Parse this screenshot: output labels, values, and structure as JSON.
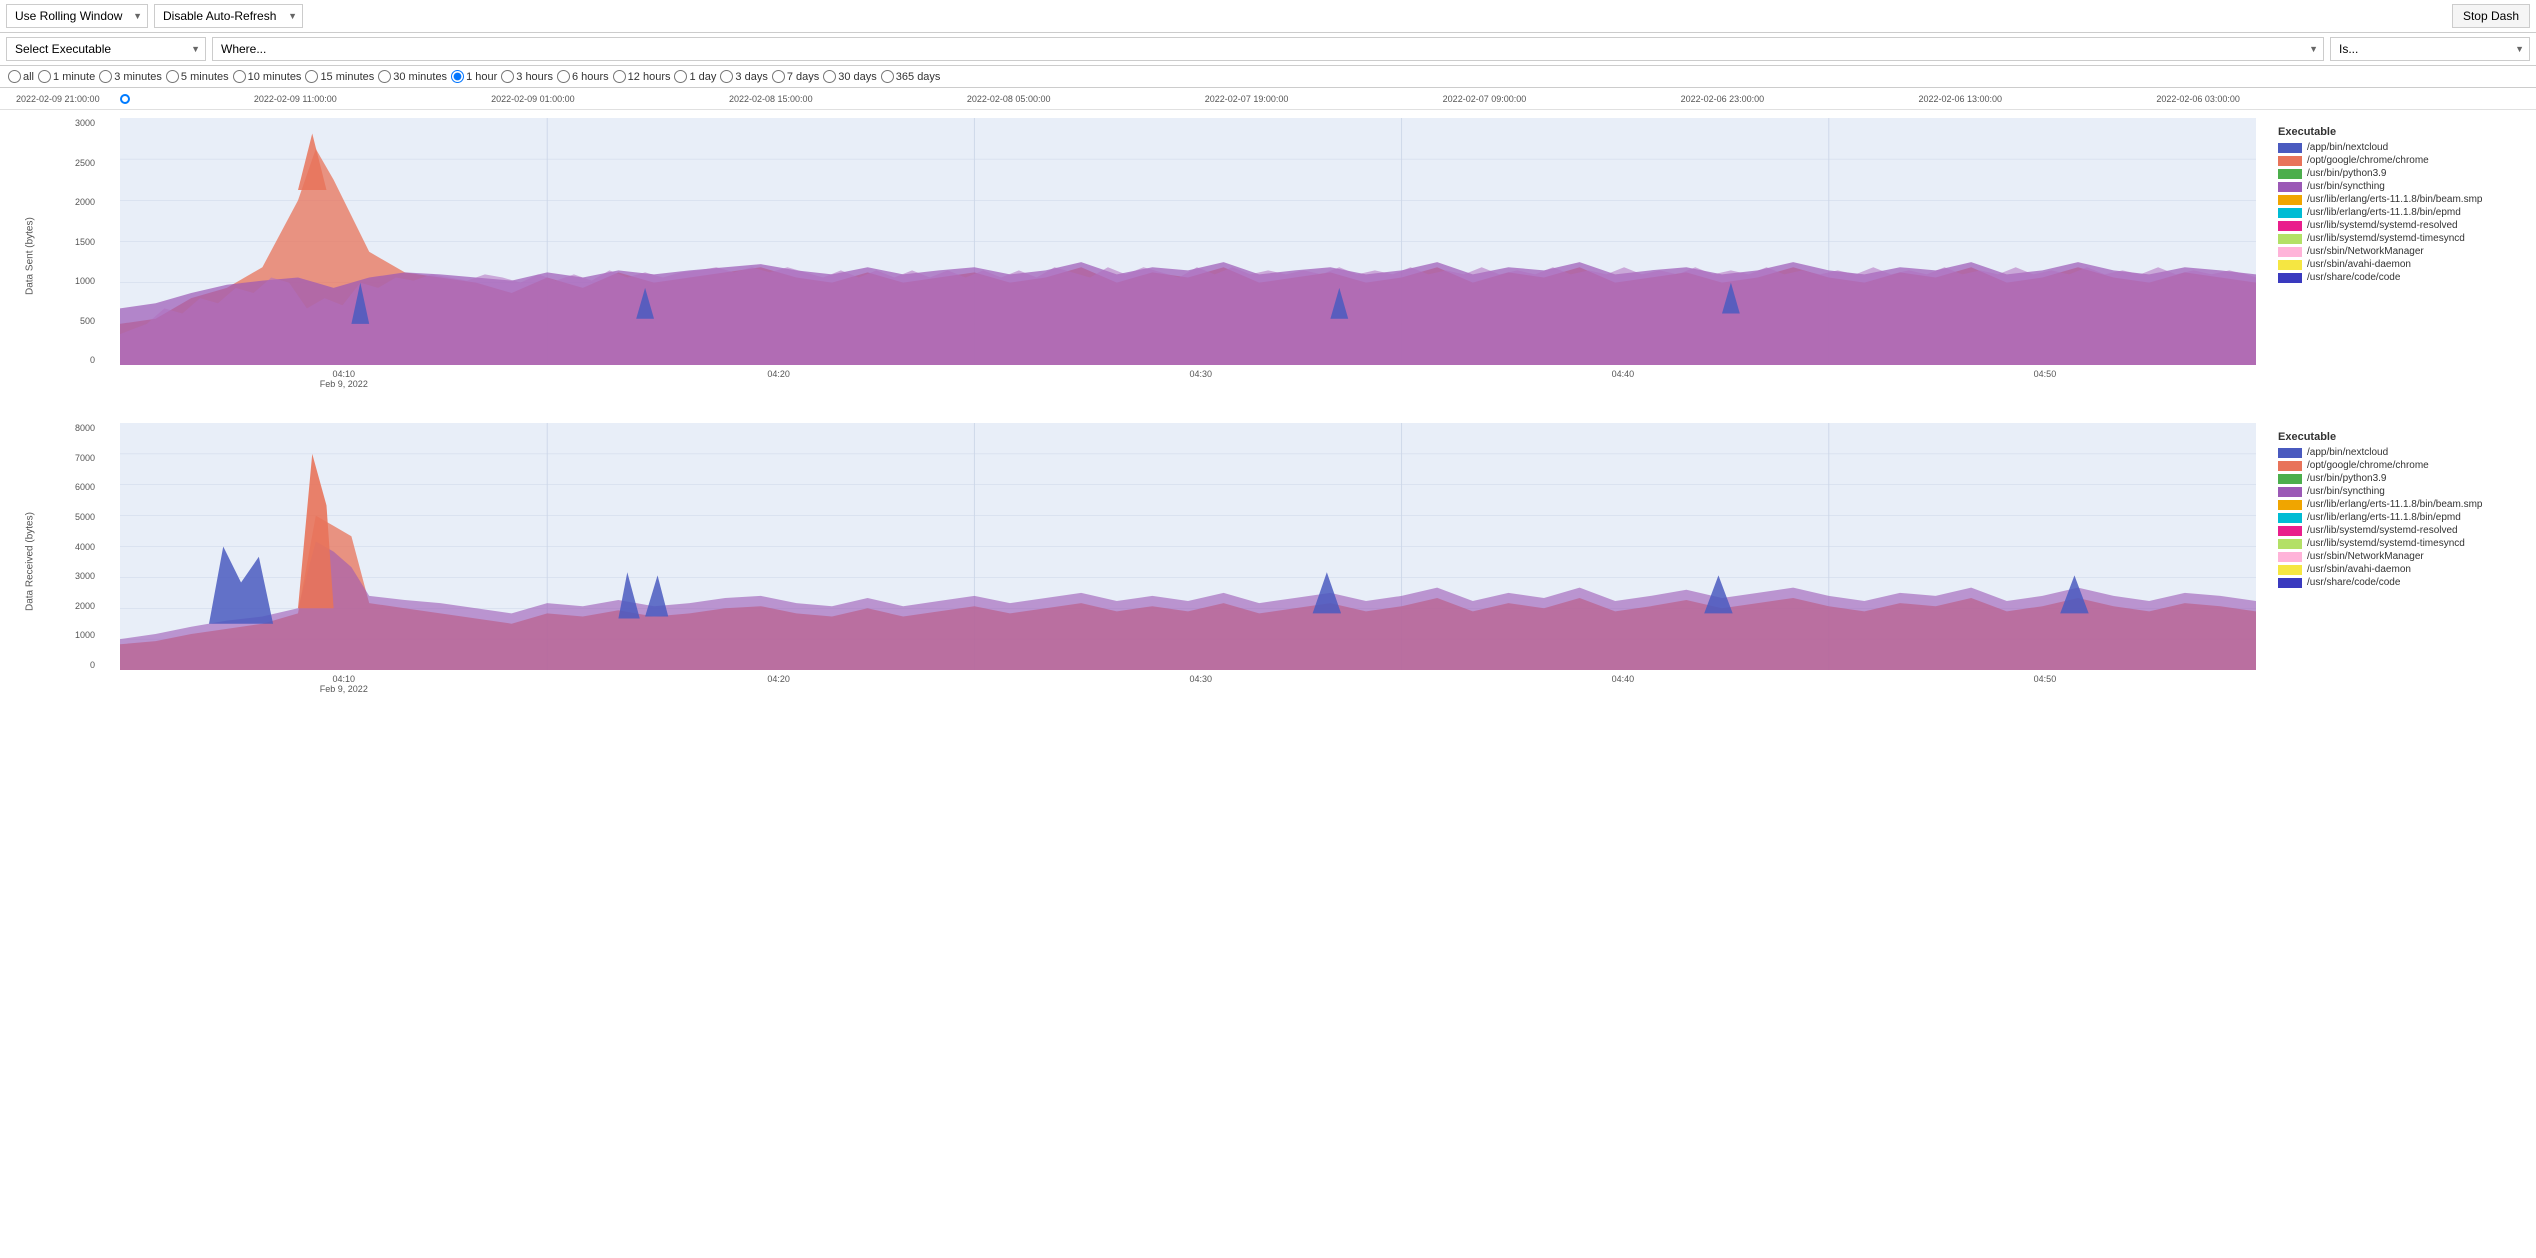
{
  "topBar": {
    "rollingWindowLabel": "Use Rolling Window",
    "autoRefreshLabel": "Disable Auto-Refresh",
    "stopDashLabel": "Stop Dash"
  },
  "filterBar": {
    "executablePlaceholder": "Select Executable",
    "wherePlaceholder": "Where...",
    "isPlaceholder": "Is..."
  },
  "radioOptions": [
    {
      "id": "all",
      "label": "all",
      "value": "all",
      "checked": false
    },
    {
      "id": "1min",
      "label": "1 minute",
      "value": "1m",
      "checked": false
    },
    {
      "id": "3min",
      "label": "3 minutes",
      "value": "3m",
      "checked": false
    },
    {
      "id": "5min",
      "label": "5 minutes",
      "value": "5m",
      "checked": false
    },
    {
      "id": "10min",
      "label": "10 minutes",
      "value": "10m",
      "checked": false
    },
    {
      "id": "15min",
      "label": "15 minutes",
      "value": "15m",
      "checked": false
    },
    {
      "id": "30min",
      "label": "30 minutes",
      "value": "30m",
      "checked": false
    },
    {
      "id": "1hr",
      "label": "1 hour",
      "value": "1h",
      "checked": true
    },
    {
      "id": "3hr",
      "label": "3 hours",
      "value": "3h",
      "checked": false
    },
    {
      "id": "6hr",
      "label": "6 hours",
      "value": "6h",
      "checked": false
    },
    {
      "id": "12hr",
      "label": "12 hours",
      "value": "12h",
      "checked": false
    },
    {
      "id": "1day",
      "label": "1 day",
      "value": "1d",
      "checked": false
    },
    {
      "id": "3day",
      "label": "3 days",
      "value": "3d",
      "checked": false
    },
    {
      "id": "7day",
      "label": "7 days",
      "value": "7d",
      "checked": false
    },
    {
      "id": "30day",
      "label": "30 days",
      "value": "30d",
      "checked": false
    },
    {
      "id": "365day",
      "label": "365 days",
      "value": "365d",
      "checked": false
    }
  ],
  "timelineLabels": [
    "2022-02-09 21:00:00",
    "2022-02-09 11:00:00",
    "2022-02-09 01:00:00",
    "2022-02-08 15:00:00",
    "2022-02-08 05:00:00",
    "2022-02-07 19:00:00",
    "2022-02-07 09:00:00",
    "2022-02-06 23:00:00",
    "2022-02-06 13:00:00",
    "2022-02-06 03:00:00"
  ],
  "chart1": {
    "title": "Data Sent (bytes)",
    "yAxisLabel": "Data Sent (bytes)",
    "yTicks": [
      "3000",
      "2500",
      "2000",
      "1500",
      "1000",
      "500",
      "0"
    ],
    "xTicks": [
      {
        "label": "04:10",
        "sub": "Feb 9, 2022"
      },
      {
        "label": "04:20",
        "sub": ""
      },
      {
        "label": "04:30",
        "sub": ""
      },
      {
        "label": "04:40",
        "sub": ""
      },
      {
        "label": "04:50",
        "sub": ""
      }
    ],
    "legend": {
      "title": "Executable",
      "items": [
        {
          "color": "#4a5abf",
          "label": "/app/bin/nextcloud"
        },
        {
          "color": "#e8735a",
          "label": "/opt/google/chrome/chrome"
        },
        {
          "color": "#4cae4c",
          "label": "/usr/bin/python3.9"
        },
        {
          "color": "#9b59b6",
          "label": "/usr/bin/syncthing"
        },
        {
          "color": "#f0a500",
          "label": "/usr/lib/erlang/erts-11.1.8/bin/beam.smp"
        },
        {
          "color": "#00bcd4",
          "label": "/usr/lib/erlang/erts-11.1.8/bin/epmd"
        },
        {
          "color": "#e91e8c",
          "label": "/usr/lib/systemd/systemd-resolved"
        },
        {
          "color": "#b3e066",
          "label": "/usr/lib/systemd/systemd-timesyncd"
        },
        {
          "color": "#ffb3d9",
          "label": "/usr/sbin/NetworkManager"
        },
        {
          "color": "#f5e642",
          "label": "/usr/sbin/avahi-daemon"
        },
        {
          "color": "#3a3abf",
          "label": "/usr/share/code/code"
        }
      ]
    }
  },
  "chart2": {
    "title": "Data Received (bytes)",
    "yAxisLabel": "Data Received (bytes)",
    "yTicks": [
      "8000",
      "7000",
      "6000",
      "5000",
      "4000",
      "3000",
      "2000",
      "1000",
      "0"
    ],
    "xTicks": [
      {
        "label": "04:10",
        "sub": "Feb 9, 2022"
      },
      {
        "label": "04:20",
        "sub": ""
      },
      {
        "label": "04:30",
        "sub": ""
      },
      {
        "label": "04:40",
        "sub": ""
      },
      {
        "label": "04:50",
        "sub": ""
      }
    ],
    "legend": {
      "title": "Executable",
      "items": [
        {
          "color": "#4a5abf",
          "label": "/app/bin/nextcloud"
        },
        {
          "color": "#e8735a",
          "label": "/opt/google/chrome/chrome"
        },
        {
          "color": "#4cae4c",
          "label": "/usr/bin/python3.9"
        },
        {
          "color": "#9b59b6",
          "label": "/usr/bin/syncthing"
        },
        {
          "color": "#f0a500",
          "label": "/usr/lib/erlang/erts-11.1.8/bin/beam.smp"
        },
        {
          "color": "#00bcd4",
          "label": "/usr/lib/erlang/erts-11.1.8/bin/epmd"
        },
        {
          "color": "#e91e8c",
          "label": "/usr/lib/systemd/systemd-resolved"
        },
        {
          "color": "#b3e066",
          "label": "/usr/lib/systemd/systemd-timesyncd"
        },
        {
          "color": "#ffb3d9",
          "label": "/usr/sbin/NetworkManager"
        },
        {
          "color": "#f5e642",
          "label": "/usr/sbin/avahi-daemon"
        },
        {
          "color": "#3a3abf",
          "label": "/usr/share/code/code"
        }
      ]
    }
  }
}
